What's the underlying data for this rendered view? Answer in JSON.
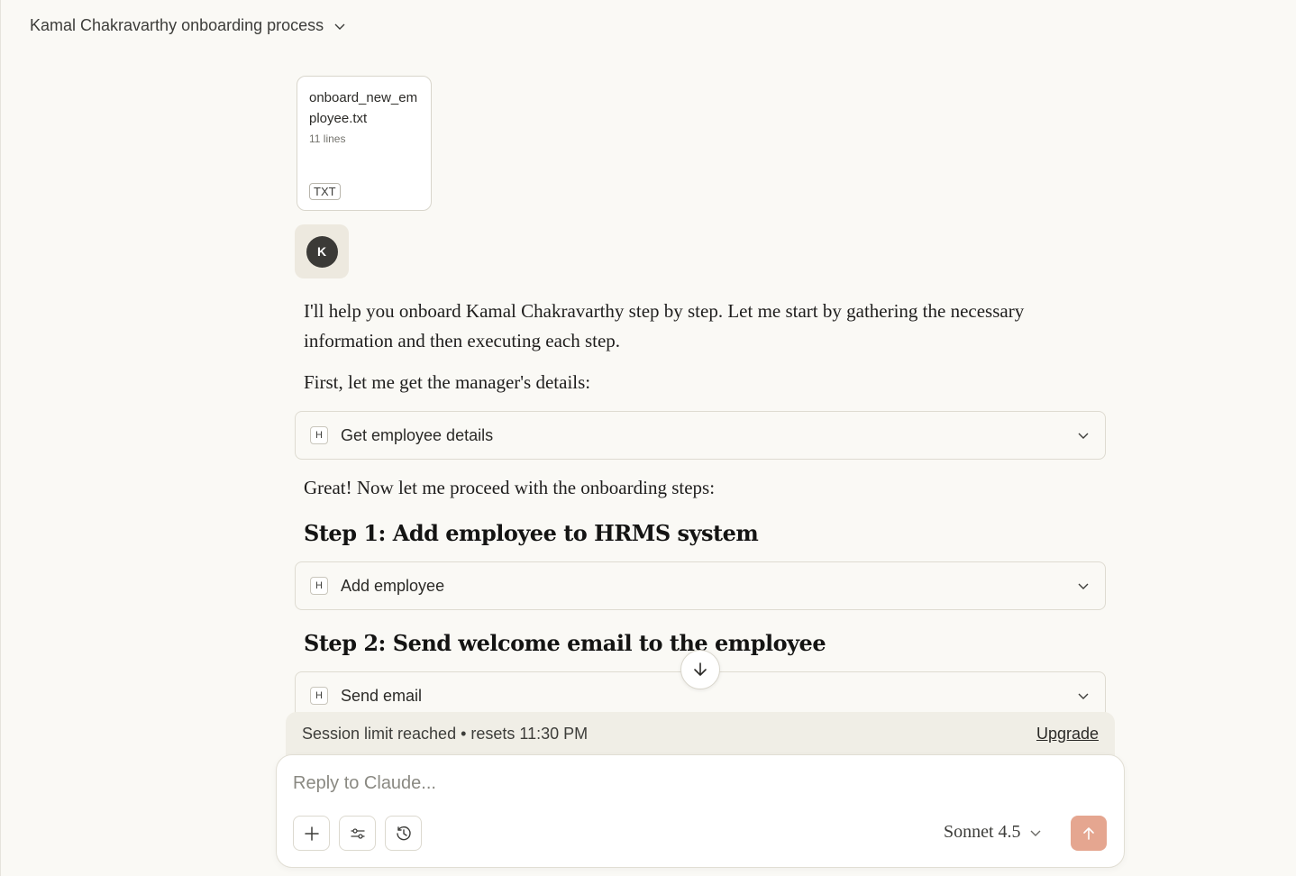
{
  "header": {
    "title": "Kamal Chakravarthy onboarding process",
    "chevron_icon": "chevron-down-icon"
  },
  "attachment": {
    "filename": "onboard_new_employee.txt",
    "lines": "11 lines",
    "type": "TXT"
  },
  "user": {
    "avatar_initial": "K"
  },
  "response": {
    "intro": "I'll help you onboard Kamal Chakravarthy step by step. Let me start by gathering the necessary information and then executing each step.",
    "manager_line": "First, let me get the manager's details:",
    "proceed_line": "Great! Now let me proceed with the onboarding steps:",
    "step1_heading": "Step 1: Add employee to HRMS system",
    "step2_heading": "Step 2: Send welcome email to the employee"
  },
  "tools": [
    {
      "icon_letter": "H",
      "label": "Get employee details"
    },
    {
      "icon_letter": "H",
      "label": "Add employee"
    },
    {
      "icon_letter": "H",
      "label": "Send email"
    }
  ],
  "banner": {
    "text": "Session limit reached • resets 11:30 PM",
    "upgrade_label": "Upgrade"
  },
  "composer": {
    "placeholder": "Reply to Claude...",
    "model": "Sonnet 4.5"
  },
  "colors": {
    "background": "#faf9f5",
    "send_button": "#e5a690",
    "banner": "#f0eee6"
  }
}
